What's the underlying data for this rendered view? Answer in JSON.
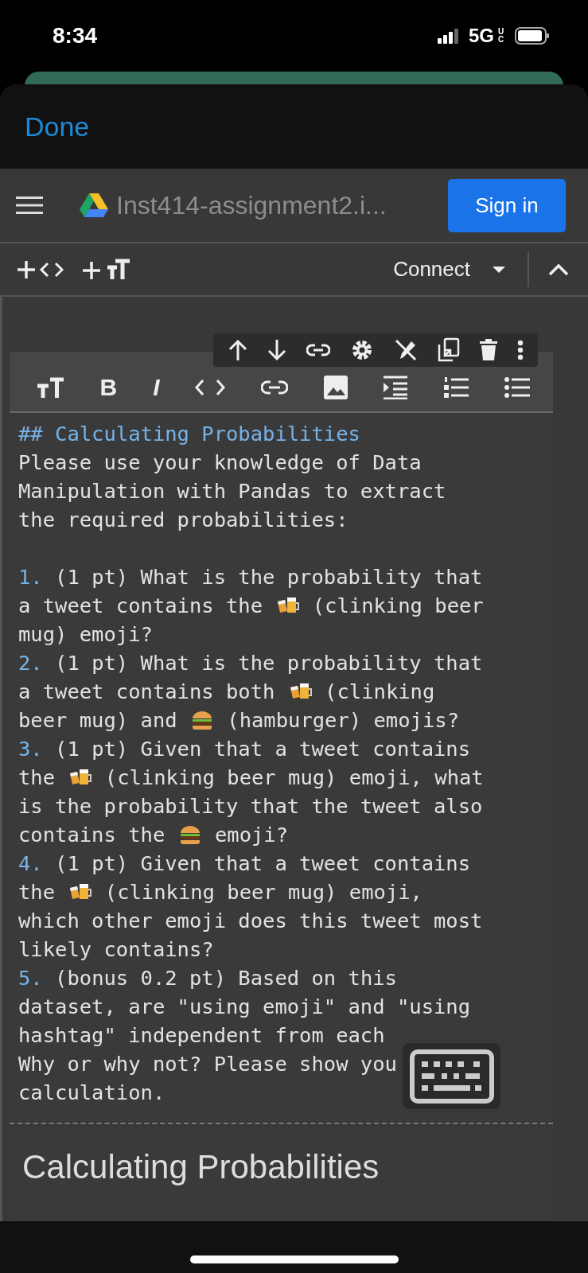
{
  "status_bar": {
    "time": "8:34",
    "network": "5G",
    "network_suffix": "UC"
  },
  "sheet": {
    "done_label": "Done"
  },
  "header": {
    "title": "Inst414-assignment2.i...",
    "sign_in_label": "Sign in"
  },
  "toolbar": {
    "connect_label": "Connect"
  },
  "format_toolbar": {
    "bold_label": "B",
    "italic_label": "I"
  },
  "editor": {
    "blocks": [
      {
        "lines": [
          {
            "parts": [
              {
                "kind": "heading",
                "text": "## Calculating Probabilities"
              }
            ]
          },
          {
            "parts": [
              {
                "kind": "text",
                "text": "Please use your knowledge of Data"
              }
            ]
          },
          {
            "parts": [
              {
                "kind": "text",
                "text": "Manipulation with Pandas to extract"
              }
            ]
          },
          {
            "parts": [
              {
                "kind": "text",
                "text": "the required probabilities:"
              }
            ]
          }
        ]
      },
      {
        "lines": [
          {
            "parts": [
              {
                "kind": "marker",
                "text": "1."
              },
              {
                "kind": "text",
                "text": " (1 pt) What is the probability that"
              }
            ]
          },
          {
            "parts": [
              {
                "kind": "text",
                "text": "a tweet contains the "
              },
              {
                "kind": "beer"
              },
              {
                "kind": "text",
                "text": " (clinking beer"
              }
            ]
          },
          {
            "parts": [
              {
                "kind": "text",
                "text": "mug) emoji?"
              }
            ]
          },
          {
            "parts": [
              {
                "kind": "marker",
                "text": "2."
              },
              {
                "kind": "text",
                "text": " (1 pt) What is the probability that"
              }
            ]
          },
          {
            "parts": [
              {
                "kind": "text",
                "text": "a tweet contains both "
              },
              {
                "kind": "beer"
              },
              {
                "kind": "text",
                "text": " (clinking"
              }
            ]
          },
          {
            "parts": [
              {
                "kind": "text",
                "text": "beer mug) and "
              },
              {
                "kind": "burger"
              },
              {
                "kind": "text",
                "text": " (hamburger) emojis?"
              }
            ]
          },
          {
            "parts": [
              {
                "kind": "marker",
                "text": "3."
              },
              {
                "kind": "text",
                "text": " (1 pt) Given that a tweet contains"
              }
            ]
          },
          {
            "parts": [
              {
                "kind": "text",
                "text": "the "
              },
              {
                "kind": "beer"
              },
              {
                "kind": "text",
                "text": " (clinking beer mug) emoji, what"
              }
            ]
          },
          {
            "parts": [
              {
                "kind": "text",
                "text": "is the probability that the tweet also"
              }
            ]
          },
          {
            "parts": [
              {
                "kind": "text",
                "text": "contains the "
              },
              {
                "kind": "burger"
              },
              {
                "kind": "text",
                "text": " emoji?"
              }
            ]
          },
          {
            "parts": [
              {
                "kind": "marker",
                "text": "4."
              },
              {
                "kind": "text",
                "text": " (1 pt) Given that a tweet contains"
              }
            ]
          },
          {
            "parts": [
              {
                "kind": "text",
                "text": "the "
              },
              {
                "kind": "beer"
              },
              {
                "kind": "text",
                "text": " (clinking beer mug) emoji,"
              }
            ]
          },
          {
            "parts": [
              {
                "kind": "text",
                "text": "which other emoji does this tweet most"
              }
            ]
          },
          {
            "parts": [
              {
                "kind": "text",
                "text": "likely contains?"
              }
            ]
          },
          {
            "parts": [
              {
                "kind": "marker",
                "text": "5."
              },
              {
                "kind": "text",
                "text": " (bonus 0.2 pt) Based on this"
              }
            ]
          },
          {
            "parts": [
              {
                "kind": "text",
                "text": "dataset, are \"using emoji\" and \"using"
              }
            ]
          },
          {
            "parts": [
              {
                "kind": "text",
                "text": "hashtag\" independent from each"
              }
            ]
          },
          {
            "parts": [
              {
                "kind": "text",
                "text": "Why or why not? Please show you"
              }
            ]
          },
          {
            "parts": [
              {
                "kind": "text",
                "text": "calculation."
              }
            ]
          }
        ]
      }
    ]
  },
  "rendered": {
    "heading": "Calculating Probabilities"
  }
}
